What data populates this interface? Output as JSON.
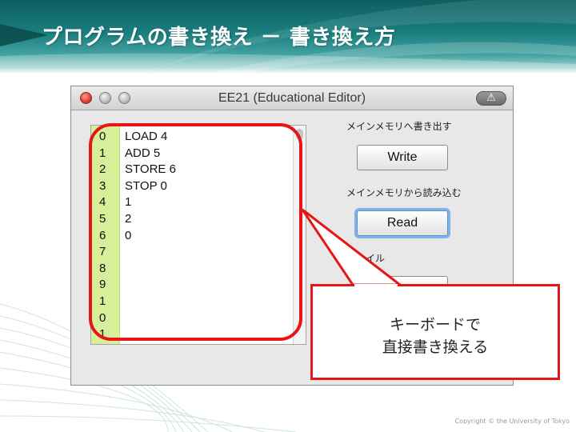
{
  "slide": {
    "title": "プログラムの書き換え － 書き換え方",
    "copyright": "Copyright © the University of Tokyo"
  },
  "window": {
    "title": "EE21 (Educational Editor)",
    "toolbar_icon": "alert-triangle-icon"
  },
  "editor": {
    "line_numbers": [
      "0",
      "1",
      "2",
      "3",
      "4",
      "5",
      "6",
      "7",
      "8",
      "9",
      "1",
      "0",
      "1"
    ],
    "lines": [
      "LOAD 4",
      "ADD 5",
      "STORE 6",
      "STOP 0",
      "1",
      "2",
      "0"
    ]
  },
  "panel": {
    "write_label": "メインメモリへ書き出す",
    "write_button": "Write",
    "read_label": "メインメモリから読み込む",
    "read_button": "Read",
    "file_label": "ファイル"
  },
  "annotation": {
    "line1": "キーボードで",
    "line2": "直接書き換える"
  },
  "colors": {
    "header": "#1a7e7f",
    "gutter": "#d8ef9a",
    "annotation_red": "#e61616",
    "focus_ring": "#7db3ea"
  }
}
